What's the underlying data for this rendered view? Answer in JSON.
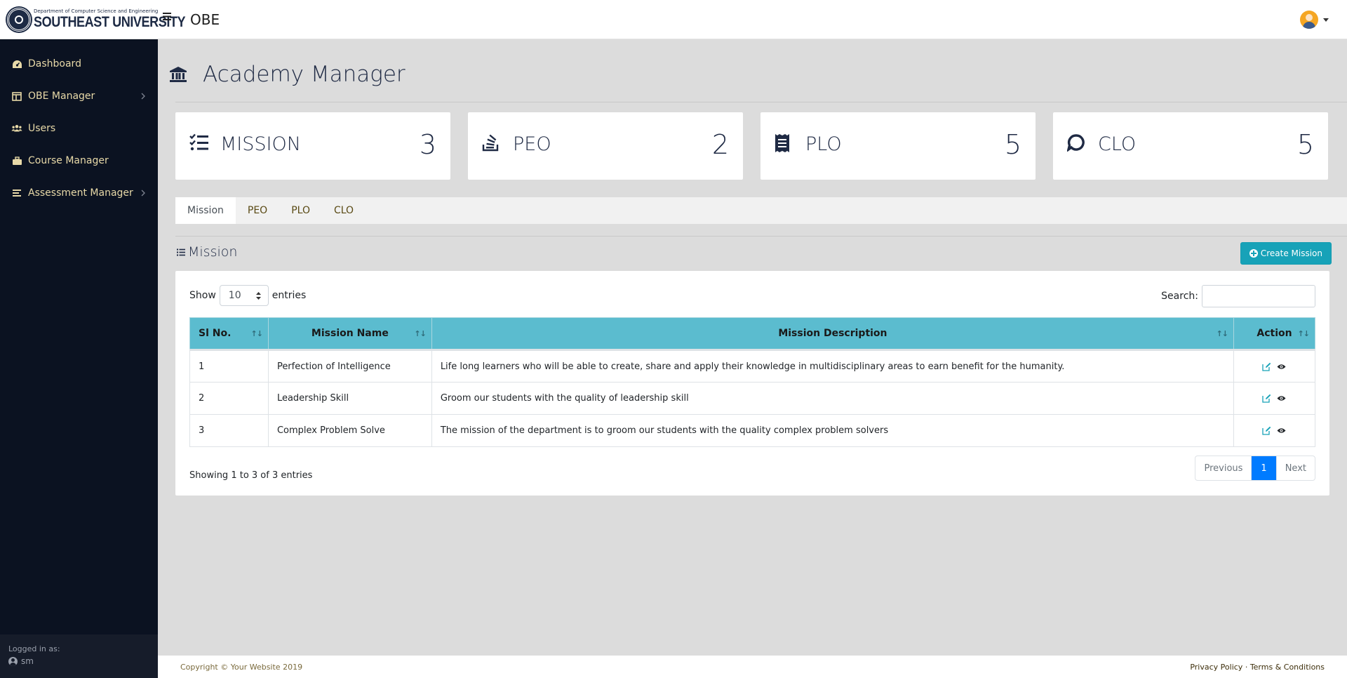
{
  "header": {
    "logo_dept": "Department of Computer Science and Engineering",
    "logo_university": "SOUTHEAST UNIVERSITY",
    "app_title": "OBE"
  },
  "sidebar": {
    "items": [
      {
        "label": "Dashboard",
        "icon": "dashboard-icon"
      },
      {
        "label": "OBE Manager",
        "icon": "columns-icon"
      },
      {
        "label": "Users",
        "icon": "users-icon"
      },
      {
        "label": "Course Manager",
        "icon": "briefcase-icon"
      },
      {
        "label": "Assessment Manager",
        "icon": "list-icon"
      }
    ],
    "logged_label": "Logged in as:",
    "logged_user": "sm"
  },
  "page": {
    "title": "Academy Manager"
  },
  "cards": [
    {
      "label": "MISSION",
      "value": "3",
      "icon": "tasks-icon"
    },
    {
      "label": "PEO",
      "value": "2",
      "icon": "stack-icon"
    },
    {
      "label": "PLO",
      "value": "5",
      "icon": "receipt-icon"
    },
    {
      "label": "CLO",
      "value": "5",
      "icon": "comment-icon"
    }
  ],
  "tabs": [
    "Mission",
    "PEO",
    "PLO",
    "CLO"
  ],
  "section": {
    "title": "Mission",
    "create_label": "Create Mission"
  },
  "table_controls": {
    "show_label": "Show",
    "entries_value": "10",
    "entries_label": "entries",
    "search_label": "Search:",
    "search_value": ""
  },
  "table": {
    "columns": [
      "Sl No.",
      "Mission Name",
      "Mission Description",
      "Action"
    ],
    "rows": [
      {
        "sl": "1",
        "name": "Perfection of Intelligence",
        "description": "Life long learners who will be able to create, share and apply their knowledge in multidisciplinary areas to earn benefit for the humanity."
      },
      {
        "sl": "2",
        "name": "Leadership Skill",
        "description": "Groom our students with the quality of leadership skill"
      },
      {
        "sl": "3",
        "name": "Complex Problem Solve",
        "description": "The mission of the department is to groom our students with the quality complex problem solvers"
      }
    ]
  },
  "pagination": {
    "info": "Showing 1 to 3 of 3 entries",
    "previous": "Previous",
    "current": "1",
    "next": "Next"
  },
  "footer": {
    "copyright": "Copyright © Your Website 2019",
    "privacy": "Privacy Policy",
    "separator": "·",
    "terms": "Terms & Conditions"
  },
  "colors": {
    "sidebar_bg": "#0b1221",
    "sidebar_text": "#e8d9a8",
    "table_header": "#5bbccf",
    "create_button": "#17a2b8",
    "pager_active": "#007bff"
  }
}
